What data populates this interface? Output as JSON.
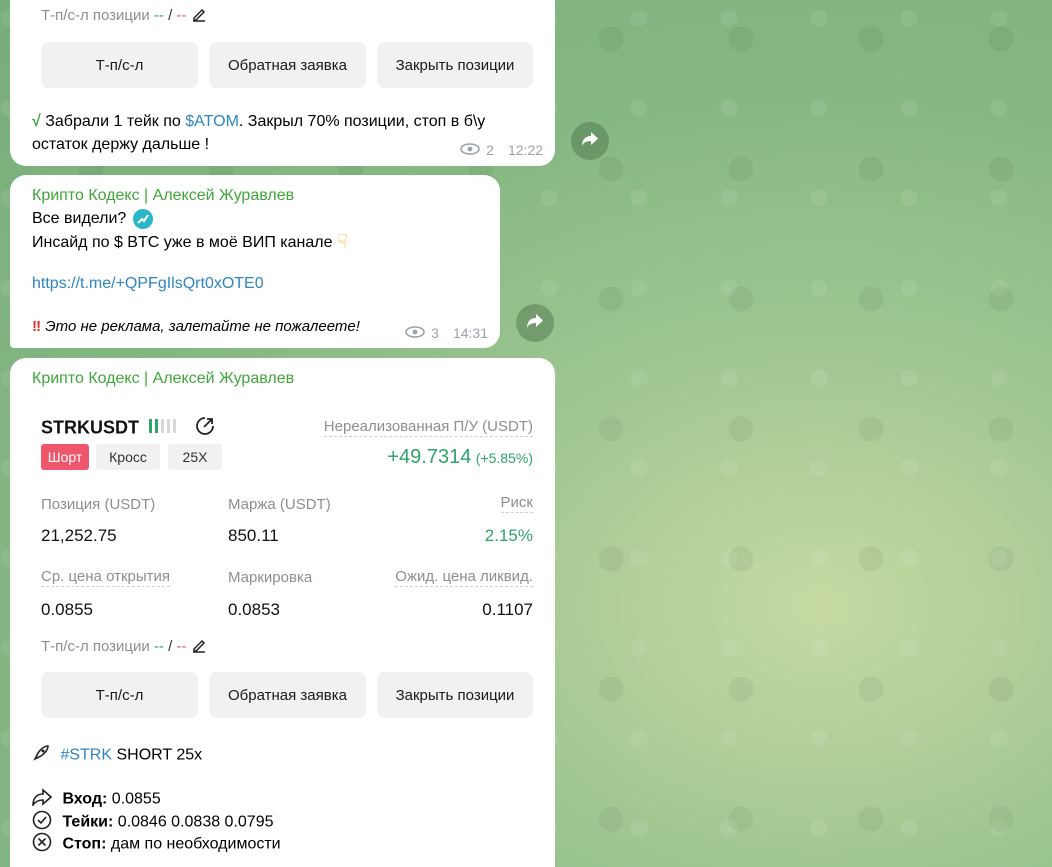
{
  "colors": {
    "sender": "#3fa63a",
    "link": "#2e86c1",
    "pnl_green": "#2fa36b",
    "short_red": "#f0566b"
  },
  "msg1": {
    "tpsl_label": "Т-п/с-л позиции",
    "tpsl_green": "--",
    "tpsl_sep": "/",
    "tpsl_red": "--",
    "buttons": [
      "Т-п/с-л",
      "Обратная заявка",
      "Закрыть позиции"
    ],
    "text_prefix": "Забрали 1 тейк по ",
    "text_ticker": "$ATOM",
    "text_suffix": ". Закрыл 70% позиции, стоп в б\\у",
    "text_line2": "остаток держу дальше !",
    "views": "2",
    "time": "12:22"
  },
  "msg2": {
    "sender": "Крипто Кодекс | Алексей Журавлев",
    "line1": "Все видели?",
    "line2": "Инсайд по $ BTC уже в моё ВИП канале",
    "link": "https://t.me/+QPFgIlsQrt0xOTE0",
    "footer": "Это не реклама, залетайте не пожалеете!",
    "views": "3",
    "time": "14:31"
  },
  "msg3": {
    "sender": "Крипто Кодекс | Алексей Журавлев",
    "card": {
      "symbol": "STRKUSDT",
      "tag_side": "Шорт",
      "tag_mode": "Кросс",
      "tag_leverage": "25X",
      "pnl_label": "Нереализованная П/У (USDT)",
      "pnl_value": "+49.7314",
      "pnl_pct": "(+5.85%)",
      "position_label": "Позиция (USDT)",
      "position_value": "21,252.75",
      "margin_label": "Маржа (USDT)",
      "margin_value": "850.11",
      "risk_label": "Риск",
      "risk_value": "2.15%",
      "entry_label": "Ср. цена открытия",
      "entry_value": "0.0855",
      "mark_label": "Маркировка",
      "mark_value": "0.0853",
      "liq_label": "Ожид. цена ликвид.",
      "liq_value": "0.1107",
      "tpsl_label": "Т-п/с-л позиции",
      "tpsl_green": "--",
      "tpsl_sep": "/",
      "tpsl_red": "--",
      "buttons": [
        "Т-п/с-л",
        "Обратная заявка",
        "Закрыть позиции"
      ]
    },
    "signal_tag": "#STRK",
    "signal_rest": " SHORT 25x",
    "entry_key": "Вход:",
    "entry_val": " 0.0855",
    "takes_key": "Тейки:",
    "takes_val": " 0.0846 0.0838 0.0795",
    "stop_key": "Стоп:",
    "stop_val": " дам по необходимости"
  }
}
